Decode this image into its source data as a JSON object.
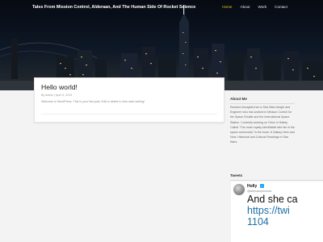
{
  "site": {
    "title": "Tales From Mission Control, Alderaan, And The Human Side Of Rocket Science"
  },
  "nav": {
    "items": [
      "Home",
      "About",
      "Work",
      "Contact"
    ],
    "active_index": 0,
    "active_color": "#f0c419"
  },
  "post": {
    "title": "Hello world!",
    "meta": "By Admin | April 5, 2019",
    "excerpt": "Welcome to WordPress. This is your first post. Edit or delete it, then start writing!"
  },
  "sidebar": {
    "about_title": "About Me",
    "about_text": "Random thoughts from a Star Wars fangirl and Engineer who has worked in Mission Control for the Space Shuttle and the International Space Station. Currently working on Orion in Safety. Called \"The most royalty-identifiable tale fan in the space community\" in the book: A Galaxy Here and Now: Historical and Cultural Readings of Star Wars.",
    "tweets_title": "Tweets",
    "tweet": {
      "name": "Holly",
      "handle": "@alderaanprincess",
      "text": "And she ca",
      "link1": "https://twi",
      "link2": "1104"
    }
  }
}
